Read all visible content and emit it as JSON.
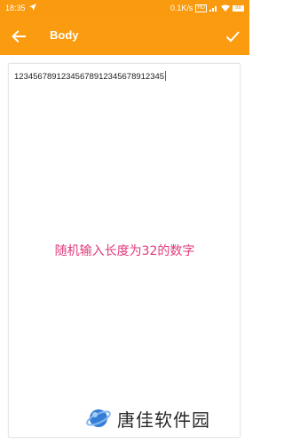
{
  "status_bar": {
    "time": "18:35",
    "network_speed": "0.1K/s",
    "hd_label": "HD",
    "battery": "88"
  },
  "app_bar": {
    "title": "Body",
    "back_icon": "arrow-left-icon",
    "confirm_icon": "check-icon"
  },
  "editor": {
    "value": "12345678912345678912345678912345"
  },
  "caption": "随机输入长度为32的数字",
  "watermark": "唐佳软件园",
  "colors": {
    "accent": "#fb9b10",
    "caption": "#e03a7c"
  }
}
